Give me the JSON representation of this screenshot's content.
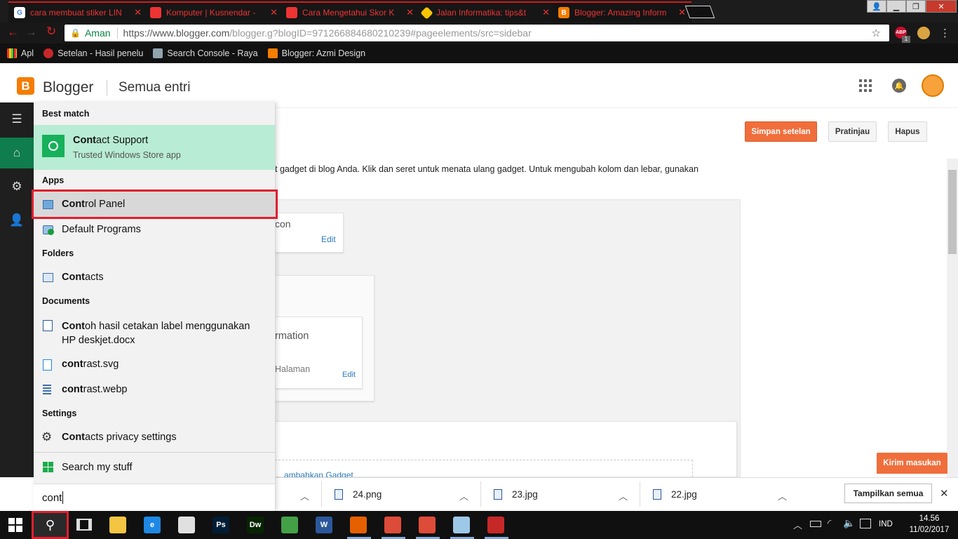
{
  "browser": {
    "tabs": [
      {
        "title": "cara membuat stiker LIN",
        "icon": "google-icon"
      },
      {
        "title": "Komputer | Kusnendar -",
        "icon": "blogger-doc-icon"
      },
      {
        "title": "Cara Mengetahui Skor K",
        "icon": "blogger-doc-icon"
      },
      {
        "title": "Jalan Informatika: tips&t",
        "icon": "ji-icon"
      },
      {
        "title": "Blogger: Amazing Inform",
        "icon": "blogger-icon"
      }
    ],
    "secure_label": "Aman",
    "url_main": "https://www.blogger.com",
    "url_rest": "/blogger.g?blogID=971266884680210239#pageelements/src=sidebar",
    "abp_label": "ABP",
    "abp_count": "1",
    "bookmarks": [
      {
        "label": "Apl"
      },
      {
        "label": "Setelan - Hasil penelu"
      },
      {
        "label": "Search Console - Raya"
      },
      {
        "label": "Blogger: Azmi Design"
      }
    ]
  },
  "blogger": {
    "logo_letter": "B",
    "brand": "Blogger",
    "section": "Semua entri",
    "save_button": "Simpan setelan",
    "preview_button": "Pratinjau",
    "delete_button": "Hapus",
    "description": "t gadget di blog Anda. Klik dan seret untuk menata ulang gadget. Untuk mengubah kolom dan lebar, gunakan",
    "gadget1_title": "con",
    "gadget1_edit": "Edit",
    "gadget2_title": "rmation",
    "gadget2_sub": "Halaman",
    "gadget2_edit": "Edit",
    "add_gadget_partial": "…ambahkan Gadget",
    "feedback_button": "Kirim masukan"
  },
  "start_search": {
    "best_match_header": "Best match",
    "best_match": {
      "title_bold": "Cont",
      "title_rest": "act Support",
      "subtitle": "Trusted Windows Store app"
    },
    "apps_header": "Apps",
    "apps": [
      {
        "bold": "Cont",
        "rest": "rol Panel",
        "icon": "control-panel-icon"
      },
      {
        "bold": "",
        "rest": "Default Programs",
        "icon": "default-programs-icon"
      }
    ],
    "folders_header": "Folders",
    "folders": [
      {
        "bold": "Cont",
        "rest": "acts",
        "icon": "contacts-folder-icon"
      }
    ],
    "documents_header": "Documents",
    "documents": [
      {
        "bold": "Cont",
        "rest": "oh hasil cetakan label menggunakan",
        "line2": "HP deskjet.docx",
        "icon": "word-doc-icon"
      },
      {
        "bold": "cont",
        "rest": "rast.svg",
        "icon": "svg-file-icon"
      },
      {
        "bold": "cont",
        "rest": "rast.webp",
        "icon": "webp-file-icon"
      }
    ],
    "settings_header": "Settings",
    "settings": [
      {
        "bold": "Cont",
        "rest": "acts privacy settings",
        "icon": "gear-icon"
      }
    ],
    "search_my_stuff": "Search my stuff",
    "query": "cont"
  },
  "downloads": {
    "items": [
      {
        "name": "24.png"
      },
      {
        "name": "23.jpg"
      },
      {
        "name": "22.jpg"
      }
    ],
    "show_all": "Tampilkan semua"
  },
  "taskbar": {
    "language": "IND",
    "time": "14.56",
    "date": "11/02/2017",
    "apps": [
      {
        "label": "",
        "icon": "file-explorer-icon",
        "color": "#f4c542"
      },
      {
        "label": "e",
        "icon": "edge-icon",
        "color": "#1e88e5"
      },
      {
        "label": "",
        "icon": "store-icon",
        "color": "#e0e0e0"
      },
      {
        "label": "Ps",
        "icon": "photoshop-icon",
        "color": "#001d34"
      },
      {
        "label": "Dw",
        "icon": "dreamweaver-icon",
        "color": "#072401"
      },
      {
        "label": "",
        "icon": "recycle-app-icon",
        "color": "#43a047"
      },
      {
        "label": "W",
        "icon": "word-icon",
        "color": "#2b579a"
      },
      {
        "label": "",
        "icon": "firefox-icon",
        "color": "#e66000"
      },
      {
        "label": "",
        "icon": "chrome-icon",
        "color": "#dd4b39"
      },
      {
        "label": "",
        "icon": "chrome-alt-icon",
        "color": "#dd4b39"
      },
      {
        "label": "",
        "icon": "notepad-icon",
        "color": "#9ec8e8"
      },
      {
        "label": "",
        "icon": "snipping-tool-icon",
        "color": "#c62828"
      }
    ]
  }
}
